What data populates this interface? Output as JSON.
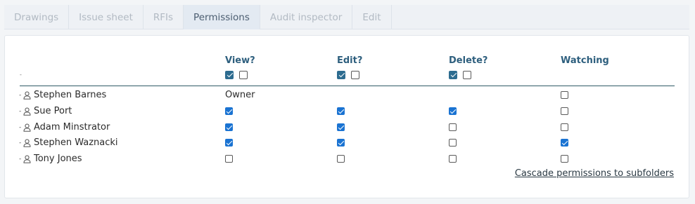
{
  "tabs": [
    {
      "label": "Drawings",
      "active": false
    },
    {
      "label": "Issue sheet",
      "active": false
    },
    {
      "label": "RFIs",
      "active": false
    },
    {
      "label": "Permissions",
      "active": true
    },
    {
      "label": "Audit inspector",
      "active": false
    },
    {
      "label": "Edit",
      "active": false
    }
  ],
  "columns": {
    "view": "View?",
    "edit": "Edit?",
    "delete": "Delete?",
    "watching": "Watching"
  },
  "header_row_label": "-",
  "header_toggles": {
    "view": [
      true,
      false
    ],
    "edit": [
      true,
      false
    ],
    "delete": [
      true,
      false
    ]
  },
  "users": [
    {
      "name": "Stephen Barnes",
      "owner_label": "Owner",
      "view": null,
      "edit": null,
      "delete": null,
      "watching": false
    },
    {
      "name": "Sue Port",
      "view": true,
      "edit": true,
      "delete": true,
      "watching": false
    },
    {
      "name": "Adam Minstrator",
      "view": true,
      "edit": true,
      "delete": false,
      "watching": false
    },
    {
      "name": "Stephen Waznacki",
      "view": true,
      "edit": true,
      "delete": false,
      "watching": true
    },
    {
      "name": "Tony Jones",
      "view": false,
      "edit": false,
      "delete": false,
      "watching": false
    }
  ],
  "row_prefix": "-",
  "user_icon": "user-icon",
  "cascade_link": "Cascade permissions to subfolders",
  "colors": {
    "header_text": "#2e5f7e",
    "checkbox_on": "#1a73d2",
    "header_checkbox_on": "#2d6c90",
    "active_tab_bg": "#e3eaf2"
  }
}
